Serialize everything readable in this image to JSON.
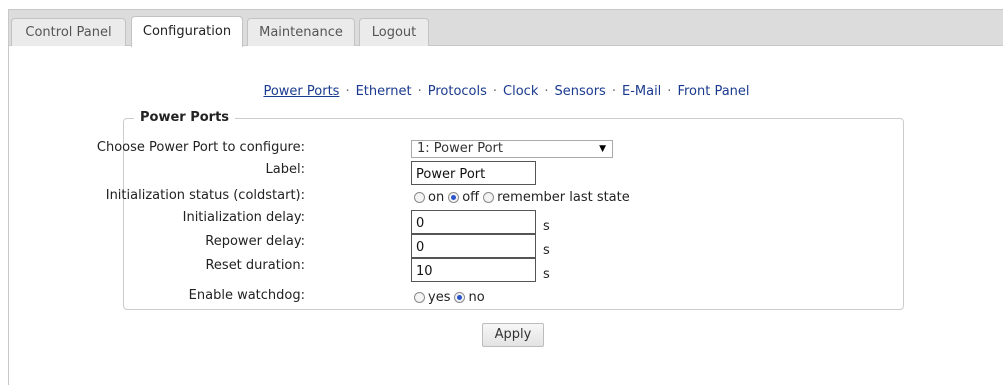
{
  "tabs": [
    {
      "label": "Control Panel",
      "active": false
    },
    {
      "label": "Configuration",
      "active": true
    },
    {
      "label": "Maintenance",
      "active": false
    },
    {
      "label": "Logout",
      "active": false
    }
  ],
  "subnav": {
    "items": [
      "Power Ports",
      "Ethernet",
      "Protocols",
      "Clock",
      "Sensors",
      "E-Mail",
      "Front Panel"
    ],
    "current": "Power Ports",
    "separator": "·"
  },
  "form": {
    "legend": "Power Ports",
    "port_select": {
      "label": "Choose Power Port to configure:",
      "value": "1: Power Port"
    },
    "label_field": {
      "label": "Label:",
      "value": "Power Port"
    },
    "init_status": {
      "label": "Initialization status (coldstart):",
      "options": [
        "on",
        "off",
        "remember last state"
      ],
      "selected": "off"
    },
    "init_delay": {
      "label": "Initialization delay:",
      "value": "0",
      "unit": "s"
    },
    "repower_delay": {
      "label": "Repower delay:",
      "value": "0",
      "unit": "s"
    },
    "reset_duration": {
      "label": "Reset duration:",
      "value": "10",
      "unit": "s"
    },
    "watchdog": {
      "label": "Enable watchdog:",
      "options": [
        "yes",
        "no"
      ],
      "selected": "no"
    },
    "apply_label": "Apply"
  },
  "colors": {
    "link": "#1a3a8f",
    "radio_checked": "#2a54c9",
    "tabbar_bg": "#dcdcdc"
  }
}
